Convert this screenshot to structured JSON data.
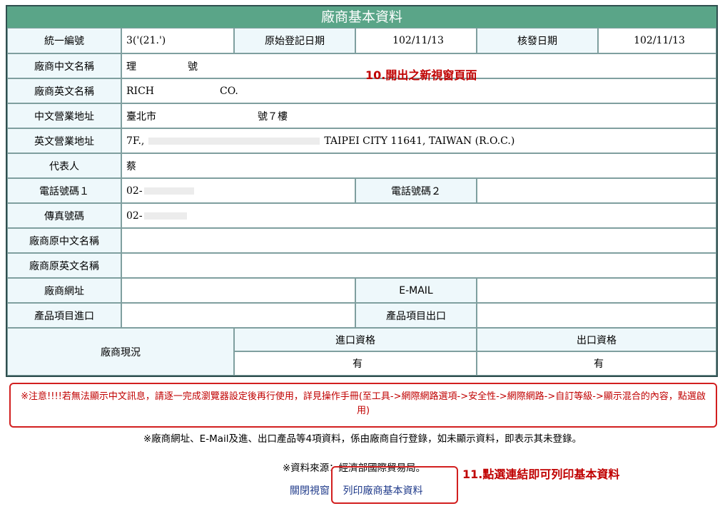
{
  "title": "廠商基本資料",
  "rows": {
    "unified_no_label": "統一編號",
    "unified_no_value": "3('(21.')",
    "orig_reg_date_label": "原始登記日期",
    "orig_reg_date_value": "102/11/13",
    "issue_date_label": "核發日期",
    "issue_date_value": "102/11/13",
    "cn_name_label": "廠商中文名稱",
    "cn_name_value_a": "理",
    "cn_name_value_b": "號",
    "en_name_label": "廠商英文名稱",
    "en_name_value_a": "RICH",
    "en_name_value_b": "CO.",
    "cn_addr_label": "中文營業地址",
    "cn_addr_value_a": "臺北市",
    "cn_addr_value_b": "號７樓",
    "en_addr_label": "英文營業地址",
    "en_addr_value_a": "7F.,",
    "en_addr_value_b": "TAIPEI CITY 11641, TAIWAN (R.O.C.)",
    "rep_label": "代表人",
    "rep_value": "蔡",
    "phone1_label": "電話號碼１",
    "phone1_value": "02-",
    "phone2_label": "電話號碼２",
    "phone2_value": "",
    "fax_label": "傳真號碼",
    "fax_value": "02-",
    "orig_cn_name_label": "廠商原中文名稱",
    "orig_cn_name_value": "",
    "orig_en_name_label": "廠商原英文名稱",
    "orig_en_name_value": "",
    "website_label": "廠商網址",
    "website_value": "",
    "email_label": "E-MAIL",
    "email_value": "",
    "import_items_label": "產品項目進口",
    "import_items_value": "",
    "export_items_label": "產品項目出口",
    "export_items_value": "",
    "status_label": "廠商現況",
    "import_qual_label": "進口資格",
    "import_qual_value": "有",
    "export_qual_label": "出口資格",
    "export_qual_value": "有"
  },
  "annotations": {
    "new_window": "10.開出之新視窗頁面",
    "click_link": "11.點選連結即可列印基本資料"
  },
  "warning": "※注意!!!!若無法顯示中文訊息，請逐一完成瀏覽器設定後再行使用，詳見操作手冊(至工具->網際網路選項->安全性->網際網路->自訂等級->顯示混合的內容，點選啟用)",
  "note_self_register": "※廠商網址、E-Mail及進、出口產品等4項資料，係由廠商自行登錄，如未顯示資料，即表示其未登錄。",
  "note_source": "※資料來源：經濟部國際貿易局。",
  "links": {
    "close_window": "關閉視窗",
    "print_basic": "列印廠商基本資料"
  }
}
